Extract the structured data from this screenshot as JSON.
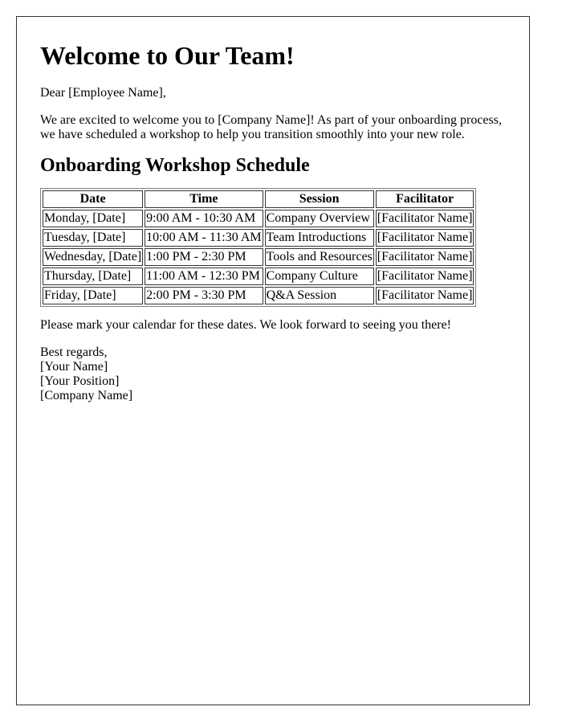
{
  "letter": {
    "title": "Welcome to Our Team!",
    "greeting": "Dear [Employee Name],",
    "intro": "We are excited to welcome you to [Company Name]! As part of your onboarding process, we have scheduled a workshop to help you transition smoothly into your new role.",
    "schedule_heading": "Onboarding Workshop Schedule",
    "closing": "Please mark your calendar for these dates. We look forward to seeing you there!",
    "signoff": {
      "regards": "Best regards,",
      "name": "[Your Name]",
      "position": "[Your Position]",
      "company": "[Company Name]"
    }
  },
  "schedule": {
    "headers": [
      "Date",
      "Time",
      "Session",
      "Facilitator"
    ],
    "rows": [
      [
        "Monday, [Date]",
        "9:00 AM - 10:30 AM",
        "Company Overview",
        "[Facilitator Name]"
      ],
      [
        "Tuesday, [Date]",
        "10:00 AM - 11:30 AM",
        "Team Introductions",
        "[Facilitator Name]"
      ],
      [
        "Wednesday, [Date]",
        "1:00 PM - 2:30 PM",
        "Tools and Resources",
        "[Facilitator Name]"
      ],
      [
        "Thursday, [Date]",
        "11:00 AM - 12:30 PM",
        "Company Culture",
        "[Facilitator Name]"
      ],
      [
        "Friday, [Date]",
        "2:00 PM - 3:30 PM",
        "Q&A Session",
        "[Facilitator Name]"
      ]
    ]
  }
}
